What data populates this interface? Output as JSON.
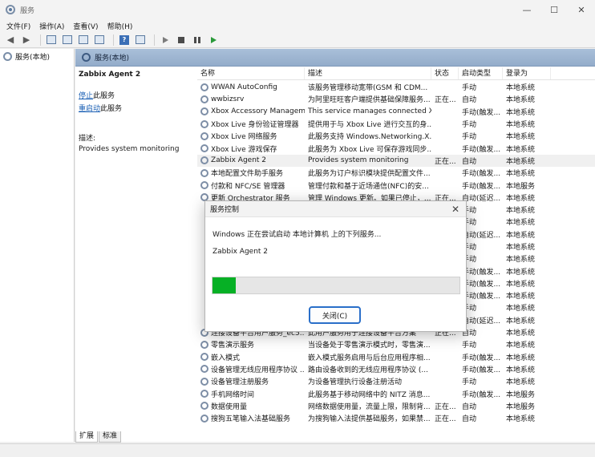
{
  "window": {
    "title": "服务",
    "controls": [
      "—",
      "☐",
      "✕"
    ]
  },
  "menu": [
    "文件(F)",
    "操作(A)",
    "查看(V)",
    "帮助(H)"
  ],
  "tree": {
    "root": "服务(本地)"
  },
  "panel": {
    "header": "服务(本地)"
  },
  "detail": {
    "service_name": "Zabbix Agent 2",
    "stop_link": "停止",
    "stop_suffix": "此服务",
    "restart_link": "重启动",
    "restart_suffix": "此服务",
    "desc_label": "描述:",
    "desc_text": "Provides system monitoring"
  },
  "columns": [
    "名称",
    "描述",
    "状态",
    "启动类型",
    "登录为"
  ],
  "rows": [
    {
      "name": "WWAN AutoConfig",
      "desc": "该服务管理移动宽带(GSM 和 CDM...",
      "status": "",
      "startup": "手动",
      "logon": "本地系统"
    },
    {
      "name": "wwbizsrv",
      "desc": "为阿里旺旺客户端提供基础保障服务...",
      "status": "正在...",
      "startup": "自动",
      "logon": "本地系统"
    },
    {
      "name": "Xbox Accessory Managem...",
      "desc": "This service manages connected X...",
      "status": "",
      "startup": "手动(触发...",
      "logon": "本地系统"
    },
    {
      "name": "Xbox Live 身份验证管理器",
      "desc": "提供用于与 Xbox Live 进行交互的身...",
      "status": "",
      "startup": "手动",
      "logon": "本地系统"
    },
    {
      "name": "Xbox Live 网络服务",
      "desc": "此服务支持 Windows.Networking.X...",
      "status": "",
      "startup": "手动",
      "logon": "本地系统"
    },
    {
      "name": "Xbox Live 游戏保存",
      "desc": "此服务为 Xbox Live 可保存游戏同步...",
      "status": "",
      "startup": "手动(触发...",
      "logon": "本地系统"
    },
    {
      "name": "Zabbix Agent 2",
      "desc": "Provides system monitoring",
      "status": "正在...",
      "startup": "自动",
      "logon": "本地系统"
    },
    {
      "name": "本地配置文件助手服务",
      "desc": "此服务为订户标识模块提供配置文件...",
      "status": "",
      "startup": "手动(触发...",
      "logon": "本地系统"
    },
    {
      "name": "付款和 NFC/SE 管理器",
      "desc": "管理付款和基于近场通信(NFC)的安...",
      "status": "",
      "startup": "手动(触发...",
      "logon": "本地服务"
    },
    {
      "name": "更新 Orchestrator 服务",
      "desc": "管理 Windows 更新。如果已停止，...",
      "status": "正在...",
      "startup": "自动(延迟...",
      "logon": "本地系统"
    },
    {
      "name": "",
      "desc": "",
      "status": "",
      "startup": "手动",
      "logon": "本地系统"
    },
    {
      "name": "",
      "desc": "",
      "status": "",
      "startup": "手动",
      "logon": "本地系统"
    },
    {
      "name": "",
      "desc": "",
      "status": "",
      "startup": "自动(延迟...",
      "logon": "本地系统"
    },
    {
      "name": "",
      "desc": "",
      "status": "",
      "startup": "手动",
      "logon": "本地系统"
    },
    {
      "name": "",
      "desc": "",
      "status": "",
      "startup": "手动",
      "logon": "本地系统"
    },
    {
      "name": "",
      "desc": "",
      "status": "",
      "startup": "手动(触发...",
      "logon": "本地系统"
    },
    {
      "name": "",
      "desc": "",
      "status": "",
      "startup": "手动(触发...",
      "logon": "本地系统"
    },
    {
      "name": "",
      "desc": "",
      "status": "",
      "startup": "手动(触发...",
      "logon": "本地系统"
    },
    {
      "name": "",
      "desc": "",
      "status": "",
      "startup": "手动",
      "logon": "本地系统"
    },
    {
      "name": "",
      "desc": "",
      "status": "",
      "startup": "自动(延迟...",
      "logon": "本地系统"
    },
    {
      "name": "连接设备平台用户服务_ec5...",
      "desc": "此用户服务用于连接设备平台方案",
      "status": "正在...",
      "startup": "自动",
      "logon": "本地系统"
    },
    {
      "name": "零售演示服务",
      "desc": "当设备处于零售演示模式时，零售演...",
      "status": "",
      "startup": "手动",
      "logon": "本地系统"
    },
    {
      "name": "嵌入模式",
      "desc": "嵌入模式服务启用与后台应用程序相...",
      "status": "",
      "startup": "手动(触发...",
      "logon": "本地系统"
    },
    {
      "name": "设备管理无线应用程序协议 ...",
      "desc": "路由设备收到的无线应用程序协议 (...",
      "status": "",
      "startup": "手动(触发...",
      "logon": "本地系统"
    },
    {
      "name": "设备管理注册服务",
      "desc": "为设备管理执行设备注册活动",
      "status": "",
      "startup": "手动",
      "logon": "本地系统"
    },
    {
      "name": "手机网络时间",
      "desc": "此服务基于移动网络中的 NITZ 消息...",
      "status": "",
      "startup": "手动(触发...",
      "logon": "本地服务"
    },
    {
      "name": "数据使用量",
      "desc": "网络数据使用量，流量上限，限制背...",
      "status": "正在...",
      "startup": "自动",
      "logon": "本地服务"
    },
    {
      "name": "搜狗五笔输入法基础服务",
      "desc": "为搜狗输入法提供基础服务，如果禁...",
      "status": "正在...",
      "startup": "自动",
      "logon": "本地系统"
    }
  ],
  "tabs": [
    "扩展",
    "标准"
  ],
  "dialog": {
    "title": "服务控制",
    "message": "Windows 正在尝试启动 本地计算机 上的下列服务...",
    "service": "Zabbix Agent 2",
    "progress_percent": 9.5,
    "close_button": "关闭(C)",
    "close_icon": "✕"
  }
}
